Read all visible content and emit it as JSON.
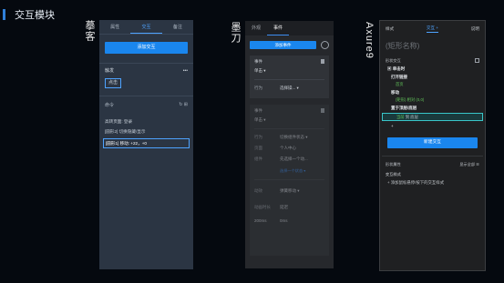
{
  "slide": {
    "title": "交互模块"
  },
  "labels": {
    "mockplus": "摹客",
    "modao": "墨刀",
    "axure": "Axure9"
  },
  "mockplus": {
    "tabs": [
      "属性",
      "交互",
      "备注"
    ],
    "add_button": "添加交互",
    "trigger_section": "触发",
    "more": "•••",
    "trigger": "点击",
    "command_section": "命令",
    "command_icons": "↻ ⊞",
    "commands": [
      "高转页面: 登录",
      "[圆形2] 切换隐藏/显示",
      "[圆形1] 移动: +22，+0"
    ]
  },
  "modao": {
    "tabs": [
      "外观",
      "事件"
    ],
    "add_button": "添加事件",
    "card1": {
      "header": "事件",
      "trash": "🗑",
      "event": "单击 ▾",
      "row_key": "行为",
      "row_value": "选择操... ▾"
    },
    "card2": {
      "header": "事件",
      "event": "单击 ▾",
      "rows": [
        {
          "k": "行为",
          "v": "切换组件状态 ▾"
        },
        {
          "k": "页面",
          "v": "个人中心"
        },
        {
          "k": "组件",
          "v": "先选择一个动..."
        }
      ],
      "link": "选择一个状态 ▾",
      "row_anim_k": "动效",
      "row_anim_v": "弹簧移动 ▾",
      "timing_keys": [
        "动画时长",
        "延迟"
      ],
      "timing_values": [
        "200ms",
        "0ms"
      ]
    }
  },
  "axure": {
    "tabs": [
      "样式",
      "交互 +",
      "说明"
    ],
    "name_placeholder": "(矩形名称)",
    "section_interactions": "形状交互",
    "event_click": "▣ 单击时",
    "case_open": "打开链接",
    "act_home_page": "首页",
    "case_move": "移动",
    "act_move": "(矩形) 相对 (0,0)",
    "case_front": "置于顶层/底层",
    "act_front_key": "当前",
    "act_front_val": "到 底层",
    "plus": "+",
    "new_button": "新建交互",
    "section_props": "形状属性",
    "show_all": "显示全部 ☰",
    "interaction_styles": "交互样式",
    "add_style": "+ 添加鼠标悬停/按下的交互样式"
  }
}
